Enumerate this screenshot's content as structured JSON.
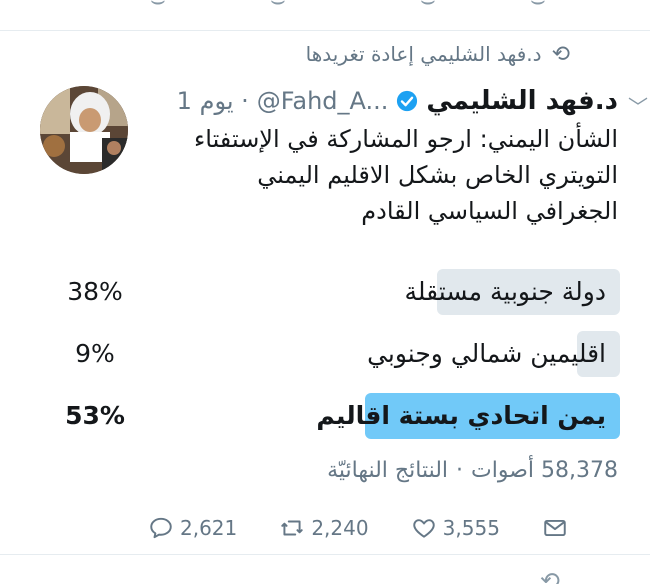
{
  "retweet_context": {
    "text": "د.فهد الشليمي إعادة تغريدها",
    "icon": "retweet-icon"
  },
  "tweet": {
    "author_name": "د.فهد الشليمي",
    "handle": "@Fahd_A...",
    "time": "1 يوم ·",
    "verified": true,
    "text_lines": [
      "الشأن اليمني: ارجو المشاركة في الإستفتاء",
      "التويتري الخاص بشكل الاقليم اليمني",
      "الجغرافي السياسي القادم"
    ],
    "poll": {
      "options": [
        {
          "label": "دولة جنوبية مستقلة",
          "percent": "38%",
          "value": 38,
          "winner": false
        },
        {
          "label": "اقليمين شمالي وجنوبي",
          "percent": "9%",
          "value": 9,
          "winner": false
        },
        {
          "label": "يمن اتحادي بستة اقاليم",
          "percent": "53%",
          "value": 53,
          "winner": true
        }
      ],
      "votes": "58,378 أصوات",
      "separator": "·",
      "status": "النتائج النهائيّة"
    },
    "actions": {
      "replies": "2,621",
      "retweets": "2,240",
      "likes": "3,555"
    }
  },
  "colors": {
    "winner_bar": "#71c9f8",
    "bar": "#e1e8ed",
    "muted": "#657786",
    "verified": "#1da1f2"
  }
}
